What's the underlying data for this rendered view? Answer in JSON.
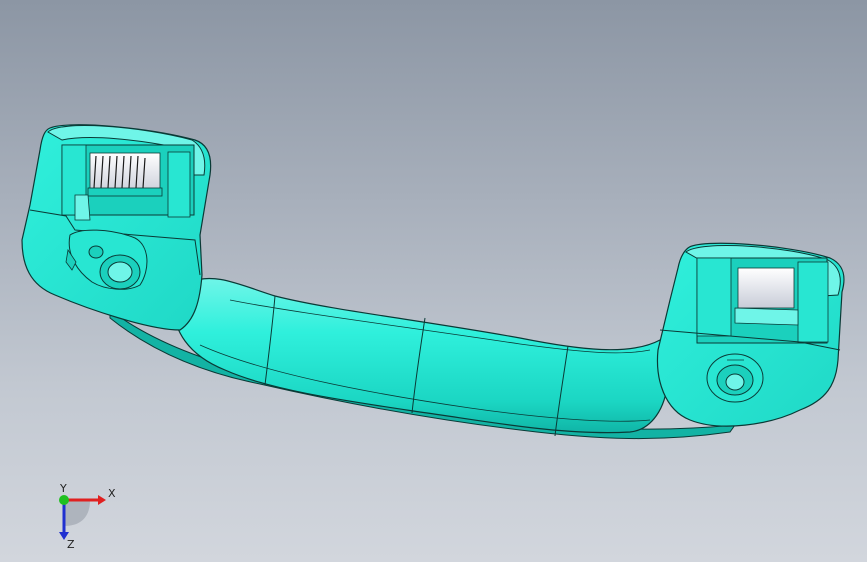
{
  "viewport": {
    "background_top": "#8c96a4",
    "background_bottom": "#d2d6dd"
  },
  "model": {
    "color": "#27ebd6",
    "shade_color": "#14c7b7",
    "highlight_color": "#7ff7ec",
    "edge_color": "#0a3a36",
    "insert_color": "#e8eaf0"
  },
  "triad": {
    "x_label": "X",
    "y_label": "Y",
    "z_label": "Z",
    "x_color": "#e02020",
    "y_color": "#20c020",
    "z_color": "#2030d0"
  }
}
